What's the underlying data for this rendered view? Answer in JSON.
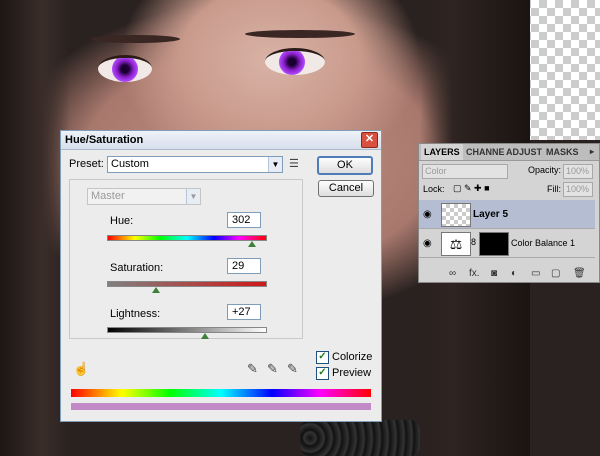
{
  "dialog": {
    "title": "Hue/Saturation",
    "close_glyph": "✕",
    "preset_label": "Preset:",
    "preset_value": "Custom",
    "channel_value": "Master",
    "ok_label": "OK",
    "cancel_label": "Cancel",
    "hue": {
      "label": "Hue:",
      "value": "302",
      "fraction": 0.92
    },
    "saturation": {
      "label": "Saturation:",
      "value": "29",
      "fraction": 0.31
    },
    "lightness": {
      "label": "Lightness:",
      "value": "+27",
      "fraction": 0.62
    },
    "colorize_label": "Colorize",
    "preview_label": "Preview",
    "colorize_checked": true,
    "preview_checked": true,
    "result_bar_color": "#c18ac6",
    "check_glyph": "✓"
  },
  "layers_panel": {
    "tabs": [
      "LAYERS",
      "CHANNE",
      "ADJUST",
      "MASKS"
    ],
    "blend_mode": "Color",
    "opacity_label": "Opacity:",
    "opacity_value": "100%",
    "lock_label": "Lock:",
    "fill_label": "Fill:",
    "fill_value": "100%",
    "layers": [
      {
        "name": "Layer 5",
        "selected": true
      },
      {
        "name": "Color Balance 1",
        "selected": false
      }
    ],
    "link_glyph": "8",
    "fx_glyph": "fx."
  },
  "icons": {
    "menu": "menu-icon",
    "hand": "hand-tool-icon",
    "eyedroppers": [
      "eyedropper-icon",
      "eyedropper-plus-icon",
      "eyedropper-minus-icon"
    ]
  }
}
